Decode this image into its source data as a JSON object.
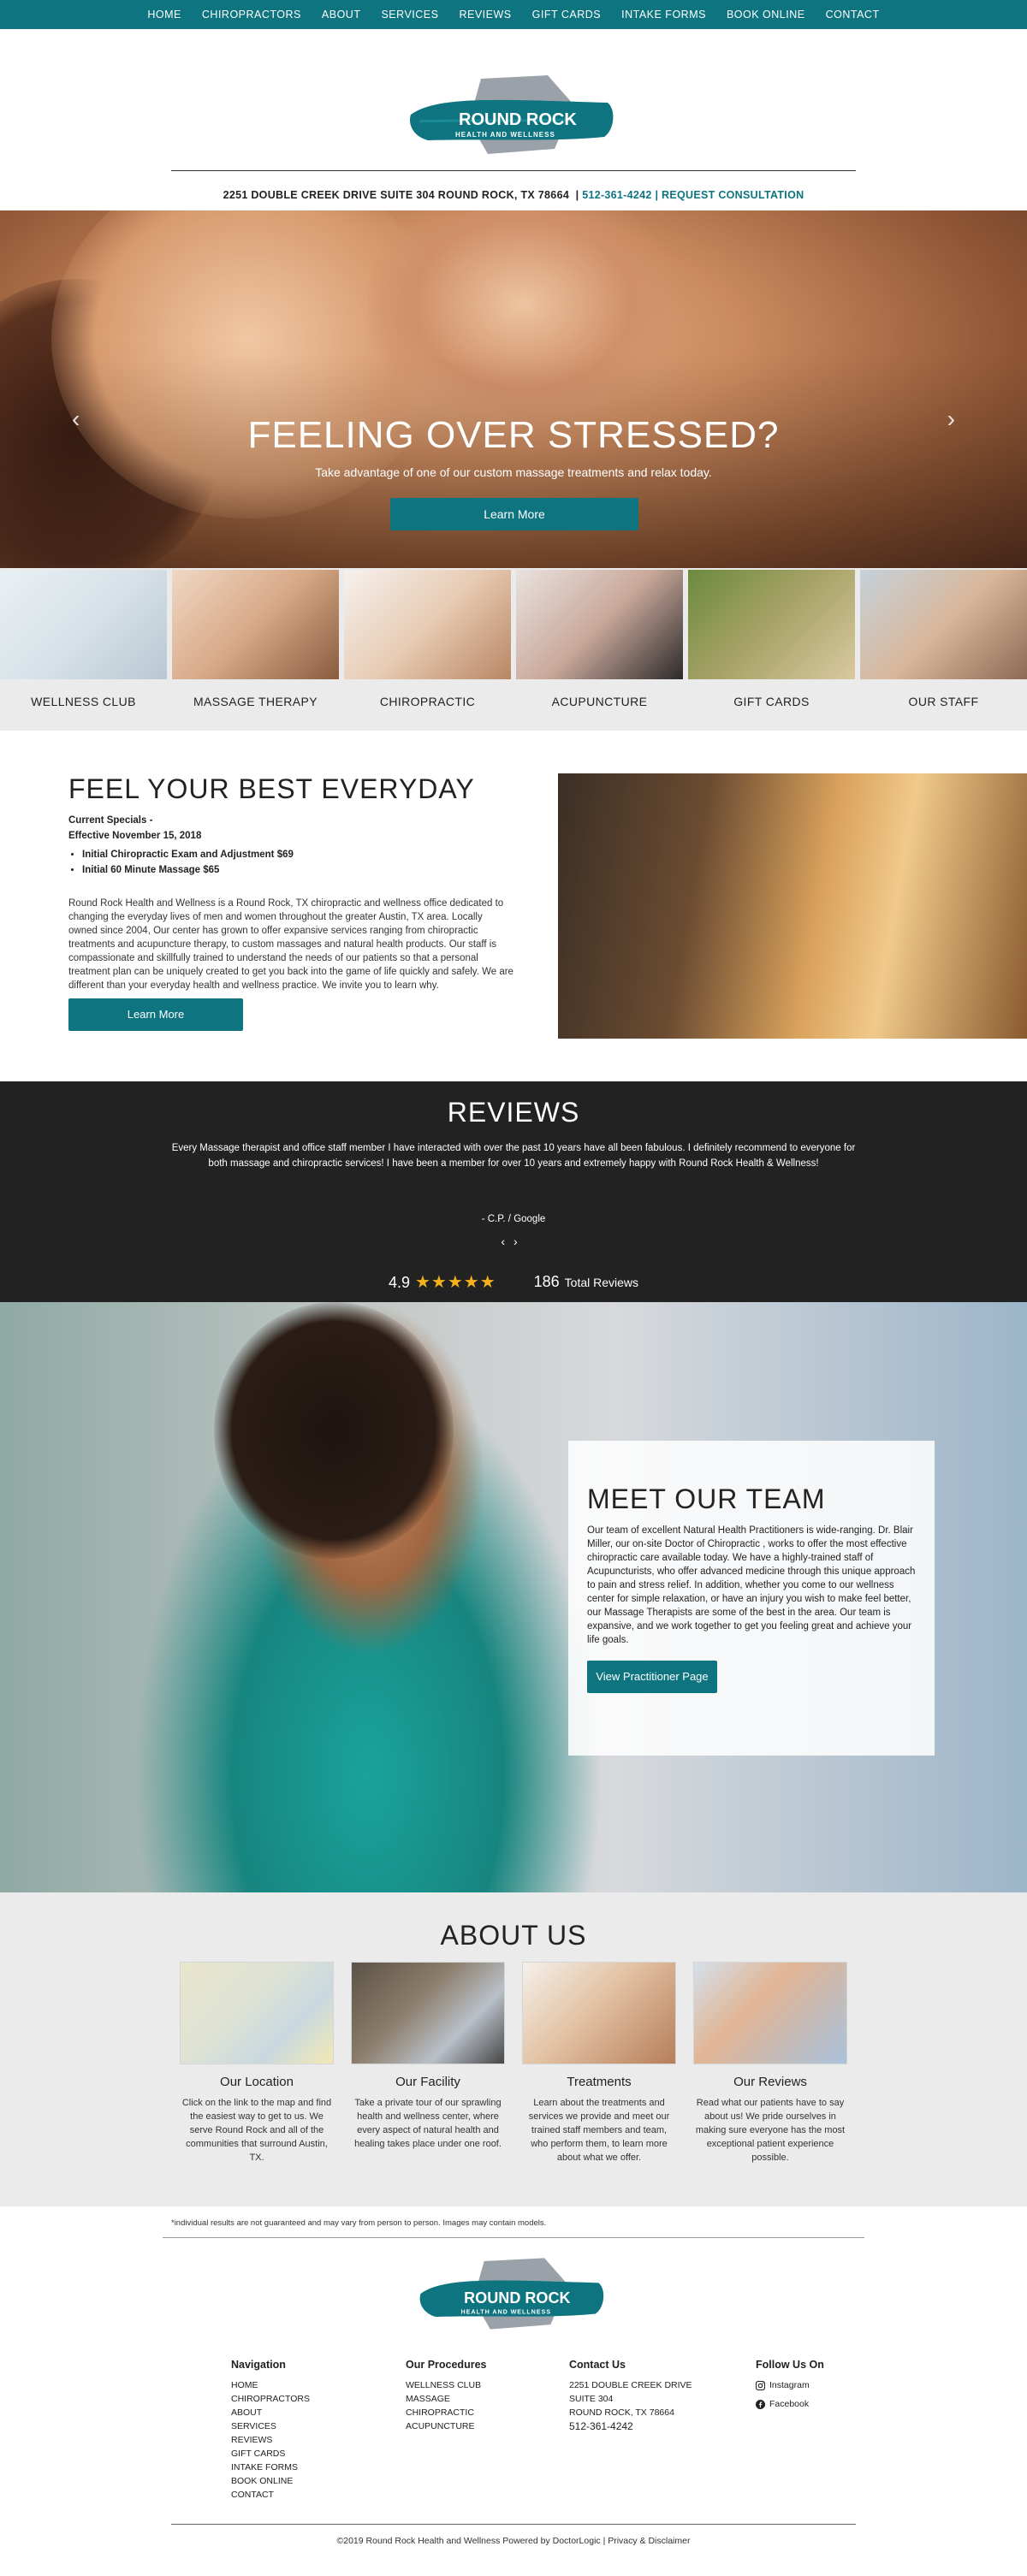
{
  "nav": [
    "HOME",
    "CHIROPRACTORS",
    "ABOUT",
    "SERVICES",
    "REVIEWS",
    "GIFT CARDS",
    "INTAKE FORMS",
    "BOOK ONLINE",
    "CONTACT"
  ],
  "brand": {
    "logo_text": "ROUND ROCK",
    "logo_tagline": "HEALTH AND WELLNESS",
    "colors": {
      "accent": "#0d7480",
      "nav_bg": "#0d7480",
      "dark_section": "#222222",
      "star": "#f5b21a"
    }
  },
  "address_bar": {
    "address": "2251 DOUBLE CREEK DRIVE SUITE 304 ROUND ROCK, TX 78664",
    "phone": "512-361-4242",
    "cta": "REQUEST CONSULTATION"
  },
  "hero": {
    "title": "FEELING OVER STRESSED?",
    "subtitle": "Take advantage of one of our custom massage treatments and relax today.",
    "button": "Learn More",
    "prev_icon": "chevron-left-icon",
    "next_icon": "chevron-right-icon"
  },
  "tiles": [
    {
      "label": "WELLNESS CLUB"
    },
    {
      "label": "MASSAGE THERAPY"
    },
    {
      "label": "CHIROPRACTIC"
    },
    {
      "label": "ACUPUNCTURE"
    },
    {
      "label": "GIFT CARDS"
    },
    {
      "label": "OUR STAFF"
    }
  ],
  "feel": {
    "title": "FEEL YOUR BEST EVERYDAY",
    "specials_title": "Current Specials -",
    "specials_date": "Effective November 15, 2018",
    "specials": [
      "Initial Chiropractic Exam and Adjustment $69",
      "Initial 60 Minute Massage $65"
    ],
    "description": "Round Rock Health and Wellness is a Round Rock, TX chiropractic and wellness office dedicated to changing the everyday lives of men and women throughout the greater Austin, TX area. Locally owned since 2004, Our center has grown to offer expansive services ranging from chiropractic treatments and acupuncture therapy, to custom massages and natural health products. Our staff is compassionate and skillfully trained to understand the needs of our patients so that a personal treatment plan can be uniquely created to get you back into the game of life quickly and safely. We are different than your everyday health and wellness practice. We invite you to learn why.",
    "button": "Learn More"
  },
  "reviews": {
    "title": "REVIEWS",
    "quote": "Every Massage therapist and office staff member I have interacted with over the past 10 years have all been fabulous. I definitely recommend to everyone for both massage and chiropractic services! I have been a member for over 10 years and extremely happy with Round Rock Health & Wellness!",
    "author": "- C.P. / Google",
    "prev": "‹",
    "next": "›",
    "rating": "4.9",
    "stars": "★★★★★",
    "total_count": "186",
    "total_label": "Total Reviews"
  },
  "team": {
    "title": "MEET OUR TEAM",
    "text": "Our team of excellent Natural Health Practitioners is wide-ranging. Dr. Blair Miller, our on-site Doctor of Chiropractic , works to offer the most effective chiropractic care available today. We have a highly-trained staff of Acupuncturists, who offer advanced medicine through this unique approach to pain and stress relief. In addition, whether you come to our wellness center for simple relaxation, or have an injury you wish to make feel better, our Massage Therapists are some of the best in the area. Our team is expansive, and we work together to get you feeling great and achieve your life goals.",
    "button": "View Practitioner Page"
  },
  "about": {
    "title": "ABOUT US",
    "items": [
      {
        "title": "Our Location",
        "text": "Click on the link to the map and find the easiest way to get to us. We serve Round Rock and all of the communities that surround Austin, TX."
      },
      {
        "title": "Our Facility",
        "text": "Take a private tour of our sprawling health and wellness center, where every aspect of natural health and healing takes place under one roof."
      },
      {
        "title": "Treatments",
        "text": "Learn about the treatments and services we provide and meet our trained staff members and team, who perform them, to learn more about what we offer."
      },
      {
        "title": "Our Reviews",
        "text": "Read what our patients have to say about us! We pride ourselves in making sure everyone has the most exceptional patient experience possible."
      }
    ]
  },
  "disclaimer": "*individual results are not guaranteed and may vary from person to person. Images may contain models.",
  "footer": {
    "nav_title": "Navigation",
    "nav_links": [
      "HOME",
      "CHIROPRACTORS",
      "ABOUT",
      "SERVICES",
      "REVIEWS",
      "GIFT CARDS",
      "INTAKE FORMS",
      "BOOK ONLINE",
      "CONTACT"
    ],
    "procedures_title": "Our Procedures",
    "procedures": [
      "WELLNESS CLUB",
      "MASSAGE",
      "CHIROPRACTIC",
      "ACUPUNCTURE"
    ],
    "contact_title": "Contact Us",
    "contact_lines": [
      "2251 DOUBLE CREEK DRIVE",
      "SUITE 304",
      "ROUND ROCK, TX 78664"
    ],
    "contact_phone": "512-361-4242",
    "follow_title": "Follow Us On",
    "social": [
      {
        "label": "Instagram",
        "icon": "instagram-icon"
      },
      {
        "label": "Facebook",
        "icon": "facebook-icon"
      }
    ],
    "copyright": "©2019 Round Rock Health and Wellness Powered by DoctorLogic | Privacy & Disclaimer"
  }
}
